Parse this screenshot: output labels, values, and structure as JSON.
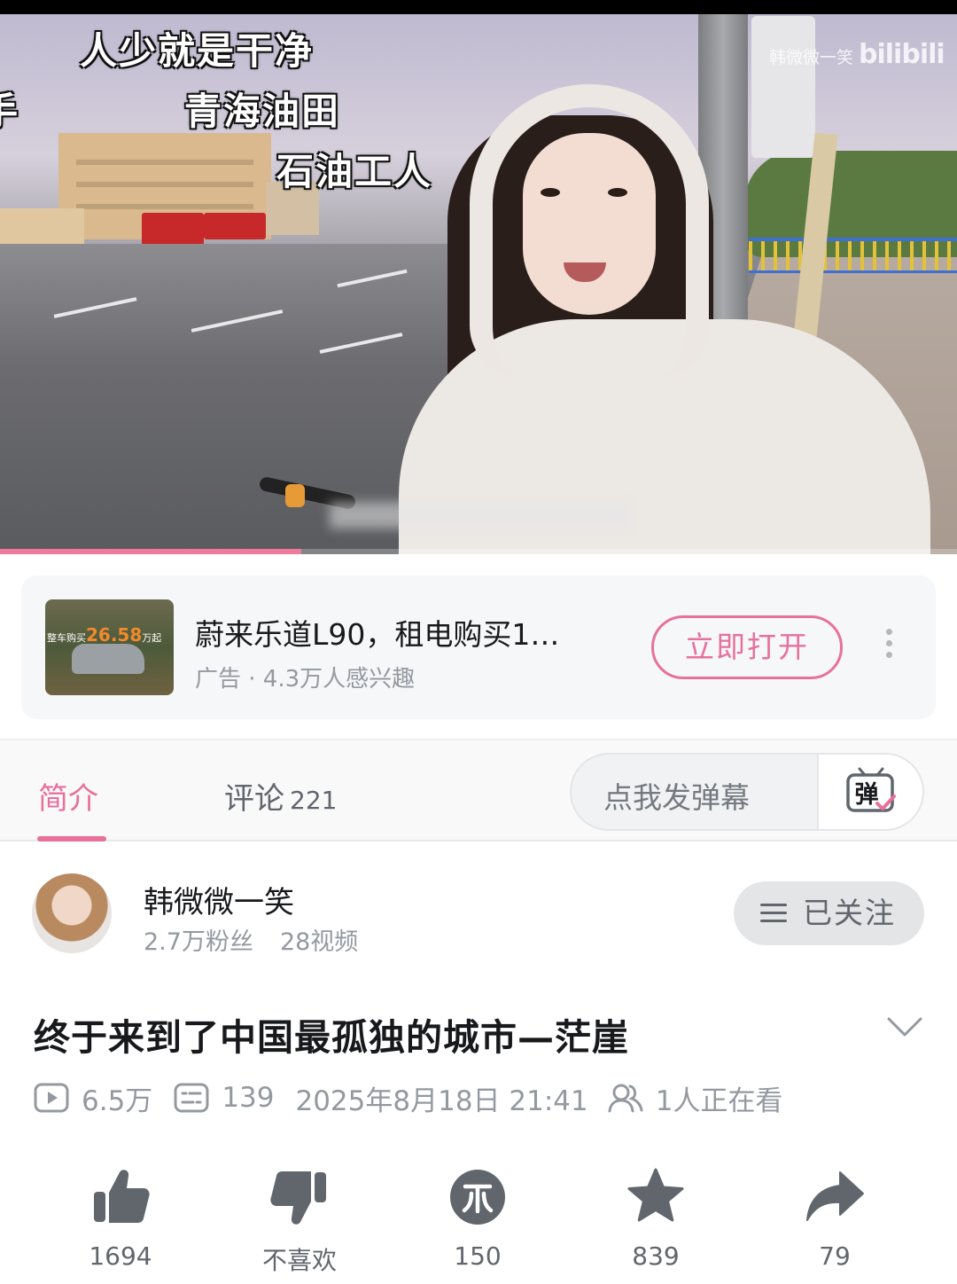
{
  "player": {
    "danmaku": [
      "人少就是干净",
      "青海油田",
      "石油工人",
      "手"
    ],
    "watermark_text": "韩微微一笑",
    "watermark_logo": "bilibili",
    "progress": 0.315,
    "accent_color": "#f07a9a"
  },
  "ad": {
    "thumb_tag": "整车购买",
    "thumb_price": "26.58",
    "thumb_unit": "万起",
    "title": "蔚来乐道L90，租电购买1…",
    "subtitle": "广告 · 4.3万人感兴趣",
    "open_label": "立即打开",
    "more_icon": "more-vertical-icon"
  },
  "tabs": {
    "intro_label": "简介",
    "comments_label": "评论",
    "comments_count": "221",
    "danmaku_placeholder": "点我发弹幕",
    "danmaku_icon_char": "弹",
    "accent_color": "#e7719a"
  },
  "uploader": {
    "name": "韩微微一笑",
    "fans": "2.7万粉丝",
    "videos": "28视频",
    "follow_label": "已关注"
  },
  "video": {
    "title": "终于来到了中国最孤独的城市—茫崖",
    "plays": "6.5万",
    "danmaku_count": "139",
    "date": "2025年8月18日 21:41",
    "watching": "1人正在看"
  },
  "actions": {
    "like": "1694",
    "dislike": "不喜欢",
    "coin": "150",
    "favorite": "839",
    "share": "79",
    "icon_color": "#61666d"
  }
}
